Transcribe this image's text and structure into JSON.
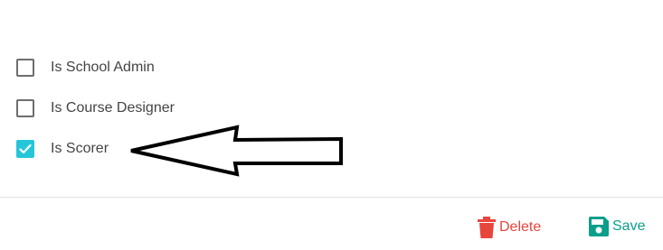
{
  "permissions": [
    {
      "label": "Is School Admin",
      "checked": false
    },
    {
      "label": "Is Course Designer",
      "checked": false
    },
    {
      "label": "Is Scorer",
      "checked": true
    }
  ],
  "annotation": {
    "icon": "left-pointing-arrow-outline",
    "color": "#000000"
  },
  "footer": {
    "delete_label": "Delete",
    "save_label": "Save",
    "delete_icon": "trash-icon",
    "save_icon": "floppy-disk-icon",
    "delete_color": "#e8453c",
    "save_color": "#0b9e8a"
  },
  "colors": {
    "checkbox_checked": "#26c6da",
    "checkbox_border": "#6e6e6e"
  }
}
